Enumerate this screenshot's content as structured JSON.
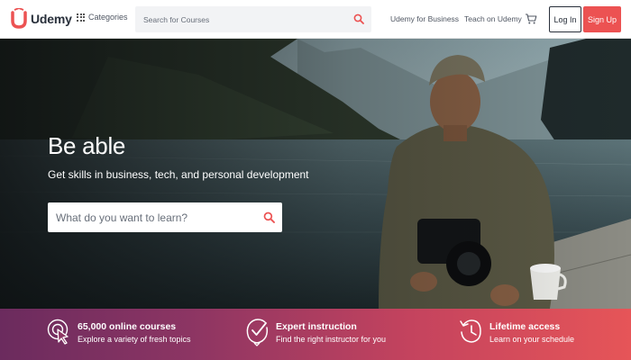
{
  "brand": {
    "name": "Udemy",
    "color": "#ec5252"
  },
  "nav": {
    "categories_label": "Categories",
    "search_placeholder": "Search for Courses",
    "business_link": "Udemy for Business",
    "teach_link": "Teach on Udemy",
    "login_label": "Log In",
    "signup_label": "Sign Up"
  },
  "hero": {
    "title": "Be able",
    "subtitle": "Get skills in business, tech, and personal development",
    "search_placeholder": "What do you want to learn?"
  },
  "features": [
    {
      "icon": "target-cursor-icon",
      "title": "65,000 online courses",
      "description": "Explore a variety of fresh topics"
    },
    {
      "icon": "checkmark-badge-icon",
      "title": "Expert instruction",
      "description": "Find the right instructor for you"
    },
    {
      "icon": "clock-history-icon",
      "title": "Lifetime access",
      "description": "Learn on your schedule"
    }
  ],
  "icons": {
    "categories": "grid-icon",
    "search": "search-icon",
    "cart": "cart-icon"
  }
}
